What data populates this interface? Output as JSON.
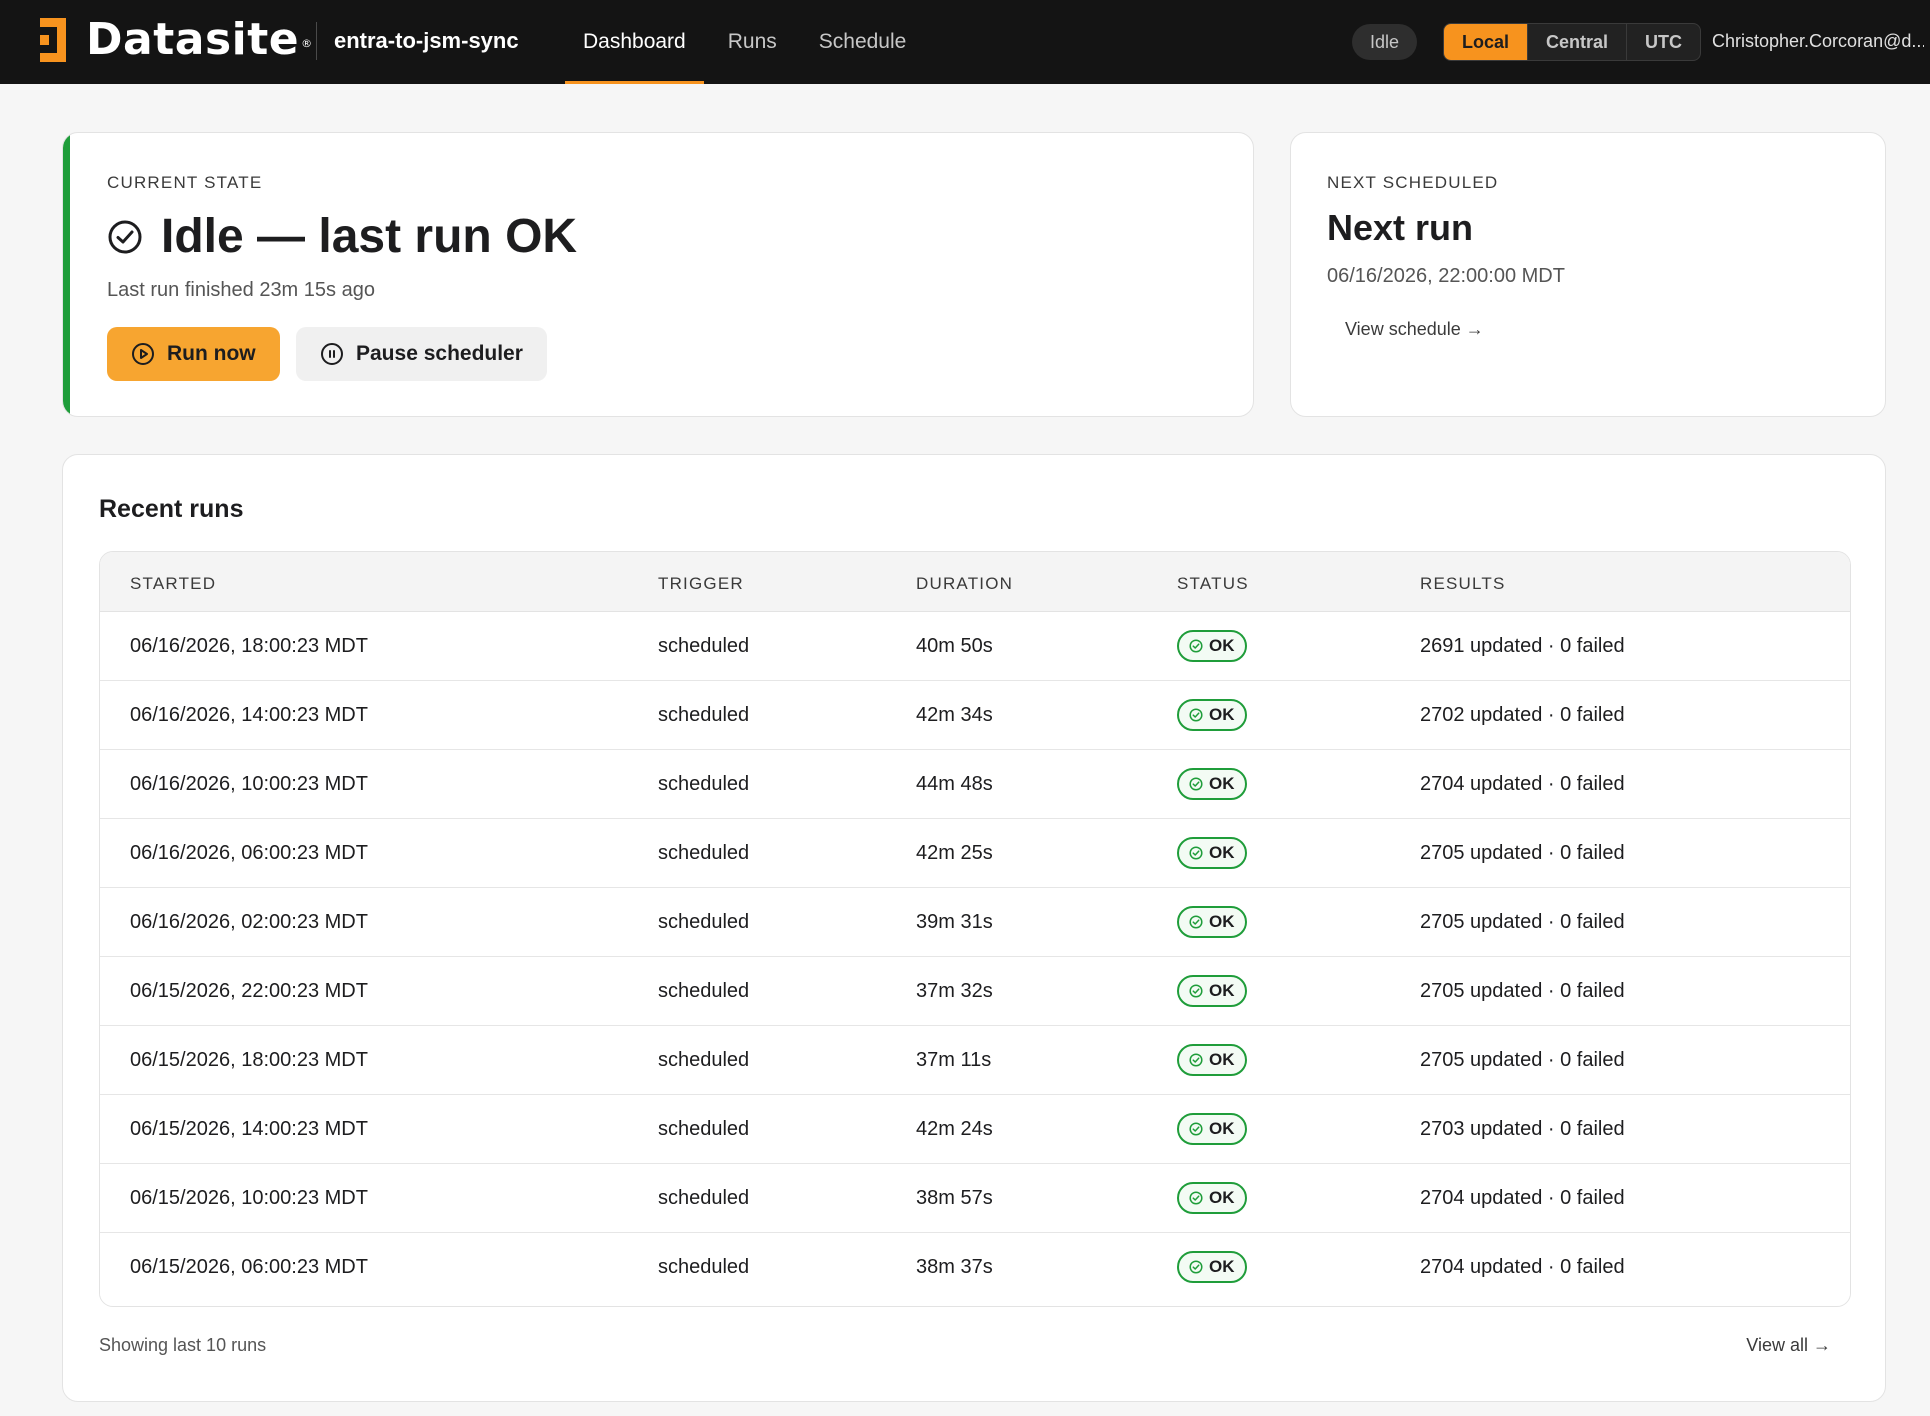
{
  "header": {
    "brand": "Datasite",
    "brand_mark": "®",
    "app_name": "entra-to-jsm-sync",
    "nav": [
      {
        "label": "Dashboard",
        "active": true
      },
      {
        "label": "Runs",
        "active": false
      },
      {
        "label": "Schedule",
        "active": false
      }
    ],
    "state_pill": "Idle",
    "timezones": [
      {
        "label": "Local",
        "active": true
      },
      {
        "label": "Central",
        "active": false
      },
      {
        "label": "UTC",
        "active": false
      }
    ],
    "user": "Christopher.Corcoran@d..."
  },
  "current_state": {
    "eyebrow": "CURRENT STATE",
    "icon": "check-circle-icon",
    "title": "Idle — last run OK",
    "subtitle": "Last run finished 23m 15s ago",
    "run_now_label": "Run now",
    "pause_label": "Pause scheduler",
    "accent_color": "#1f9d3a"
  },
  "next_scheduled": {
    "eyebrow": "NEXT SCHEDULED",
    "title": "Next run",
    "time": "06/16/2026, 22:00:00 MDT",
    "link": "View schedule →"
  },
  "recent_runs": {
    "title": "Recent runs",
    "columns": [
      "STARTED",
      "TRIGGER",
      "DURATION",
      "STATUS",
      "RESULTS"
    ],
    "rows": [
      {
        "started": "06/16/2026, 18:00:23 MDT",
        "trigger": "scheduled",
        "duration": "40m 50s",
        "status": "OK",
        "results": "2691 updated · 0 failed"
      },
      {
        "started": "06/16/2026, 14:00:23 MDT",
        "trigger": "scheduled",
        "duration": "42m 34s",
        "status": "OK",
        "results": "2702 updated · 0 failed"
      },
      {
        "started": "06/16/2026, 10:00:23 MDT",
        "trigger": "scheduled",
        "duration": "44m 48s",
        "status": "OK",
        "results": "2704 updated · 0 failed"
      },
      {
        "started": "06/16/2026, 06:00:23 MDT",
        "trigger": "scheduled",
        "duration": "42m 25s",
        "status": "OK",
        "results": "2705 updated · 0 failed"
      },
      {
        "started": "06/16/2026, 02:00:23 MDT",
        "trigger": "scheduled",
        "duration": "39m 31s",
        "status": "OK",
        "results": "2705 updated · 0 failed"
      },
      {
        "started": "06/15/2026, 22:00:23 MDT",
        "trigger": "scheduled",
        "duration": "37m 32s",
        "status": "OK",
        "results": "2705 updated · 0 failed"
      },
      {
        "started": "06/15/2026, 18:00:23 MDT",
        "trigger": "scheduled",
        "duration": "37m 11s",
        "status": "OK",
        "results": "2705 updated · 0 failed"
      },
      {
        "started": "06/15/2026, 14:00:23 MDT",
        "trigger": "scheduled",
        "duration": "42m 24s",
        "status": "OK",
        "results": "2703 updated · 0 failed"
      },
      {
        "started": "06/15/2026, 10:00:23 MDT",
        "trigger": "scheduled",
        "duration": "38m 57s",
        "status": "OK",
        "results": "2704 updated · 0 failed"
      },
      {
        "started": "06/15/2026, 06:00:23 MDT",
        "trigger": "scheduled",
        "duration": "38m 37s",
        "status": "OK",
        "results": "2704 updated · 0 failed"
      }
    ],
    "footer_left": "Showing last 10 runs",
    "footer_right": "View all →"
  },
  "colors": {
    "brand_orange": "#f7931e",
    "ok_green": "#1f9d3a",
    "topbar": "#141414"
  }
}
